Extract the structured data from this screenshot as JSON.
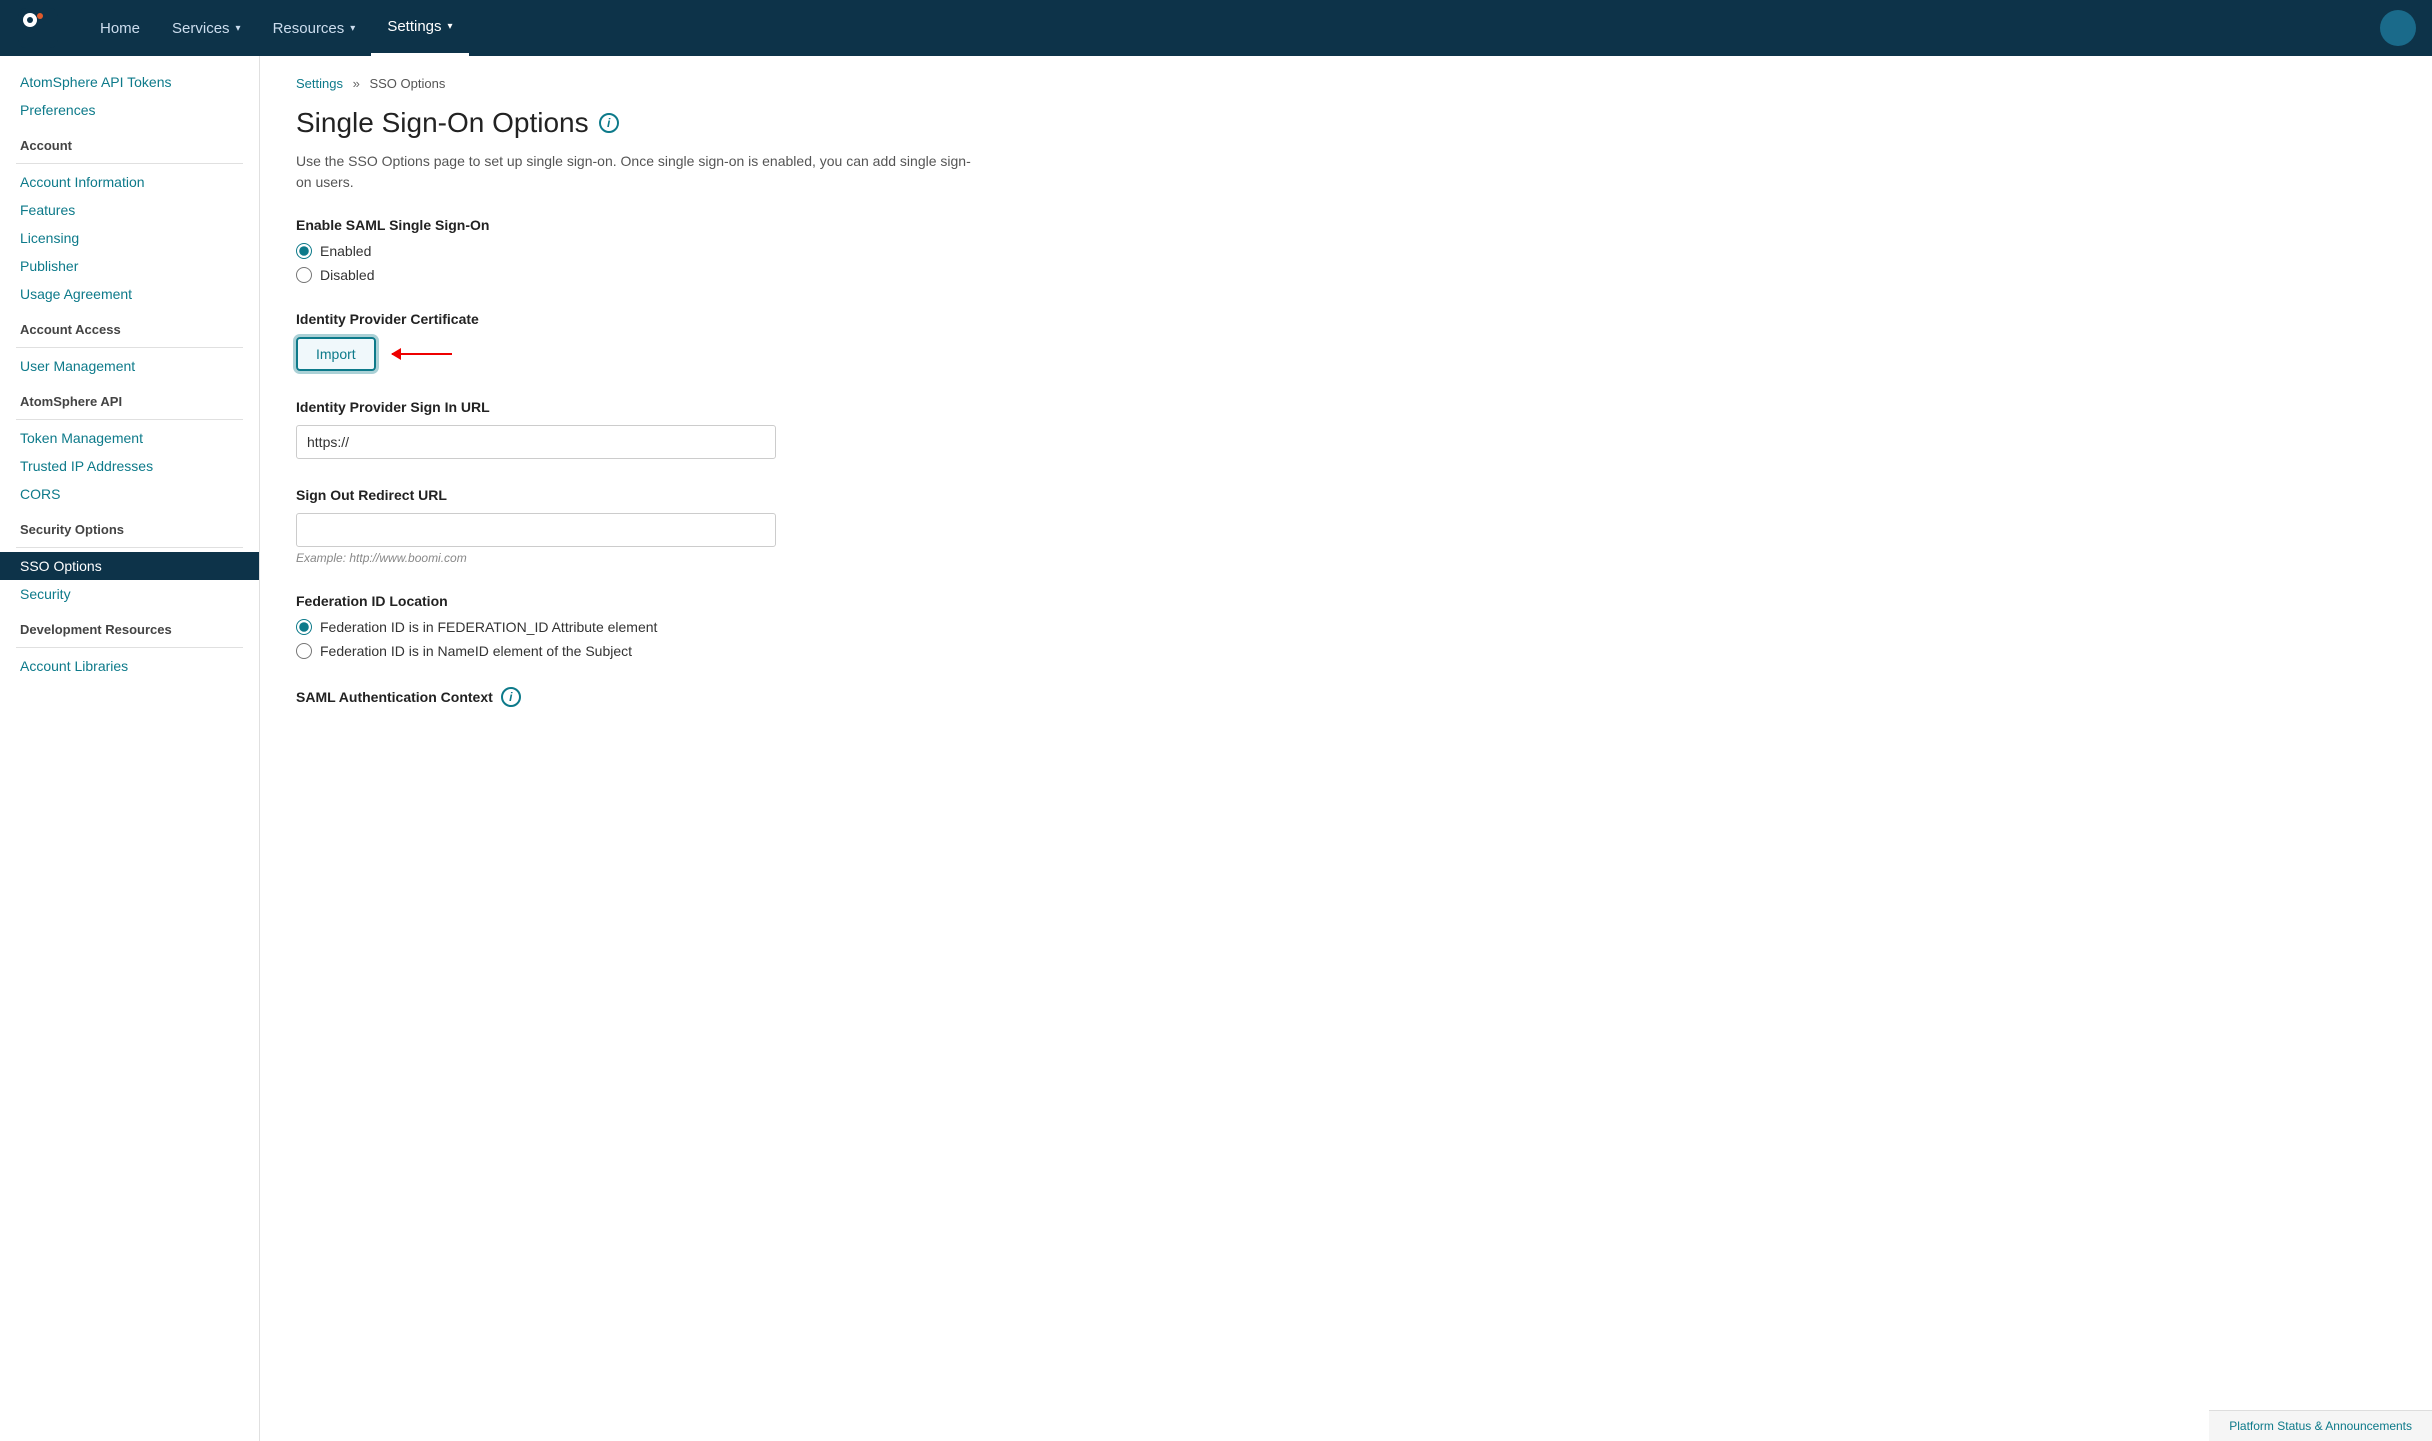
{
  "nav": {
    "items": [
      {
        "label": "Home",
        "active": false
      },
      {
        "label": "Services",
        "active": false,
        "has_caret": true
      },
      {
        "label": "Resources",
        "active": false,
        "has_caret": true
      },
      {
        "label": "Settings",
        "active": true,
        "has_caret": true
      }
    ],
    "avatar_initial": ""
  },
  "sidebar": {
    "top_links": [
      {
        "label": "AtomSphere API Tokens"
      },
      {
        "label": "Preferences"
      }
    ],
    "sections": [
      {
        "header": "Account",
        "links": [
          {
            "label": "Account Information"
          },
          {
            "label": "Features"
          },
          {
            "label": "Licensing"
          },
          {
            "label": "Publisher"
          },
          {
            "label": "Usage Agreement"
          }
        ]
      },
      {
        "header": "Account Access",
        "links": [
          {
            "label": "User Management"
          }
        ]
      },
      {
        "header": "AtomSphere API",
        "links": [
          {
            "label": "Token Management"
          },
          {
            "label": "Trusted IP Addresses"
          },
          {
            "label": "CORS"
          }
        ]
      },
      {
        "header": "Security Options",
        "links": [
          {
            "label": "SSO Options",
            "active": true
          },
          {
            "label": "Security"
          }
        ]
      },
      {
        "header": "Development Resources",
        "links": [
          {
            "label": "Account Libraries"
          }
        ]
      }
    ]
  },
  "breadcrumb": {
    "parent_label": "Settings",
    "separator": "»",
    "current_label": "SSO Options"
  },
  "page": {
    "title": "Single Sign-On Options",
    "description": "Use the SSO Options page to set up single sign-on. Once single sign-on is enabled, you can add single sign-on users.",
    "sections": {
      "enable_saml": {
        "label": "Enable SAML Single Sign-On",
        "options": [
          {
            "label": "Enabled",
            "checked": true
          },
          {
            "label": "Disabled",
            "checked": false
          }
        ]
      },
      "identity_cert": {
        "label": "Identity Provider Certificate",
        "import_button": "Import"
      },
      "sign_in_url": {
        "label": "Identity Provider Sign In URL",
        "value": "https://",
        "placeholder": "https://"
      },
      "sign_out_url": {
        "label": "Sign Out Redirect URL",
        "value": "",
        "placeholder": "",
        "hint": "Example: http://www.boomi.com"
      },
      "federation_id": {
        "label": "Federation ID Location",
        "options": [
          {
            "label": "Federation ID is in FEDERATION_ID Attribute element",
            "checked": true
          },
          {
            "label": "Federation ID is in NameID element of the Subject",
            "checked": false
          }
        ]
      },
      "saml_auth": {
        "label": "SAML Authentication Context"
      }
    }
  },
  "footer": {
    "label": "Platform Status & Announcements"
  }
}
